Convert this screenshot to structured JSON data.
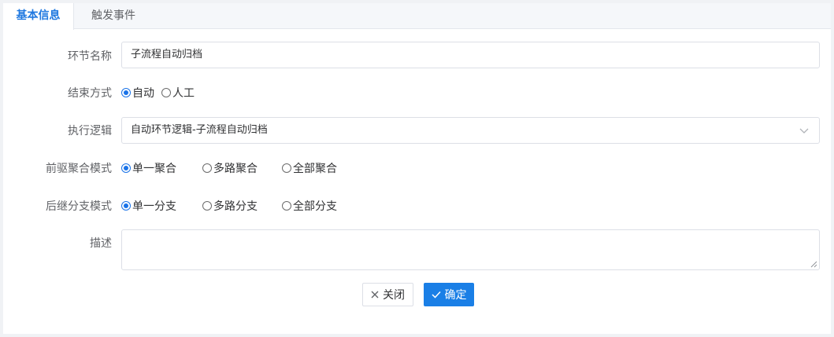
{
  "tabs": [
    {
      "label": "基本信息",
      "active": true
    },
    {
      "label": "触发事件",
      "active": false
    }
  ],
  "form": {
    "node_name": {
      "label": "环节名称",
      "value": "子流程自动归档"
    },
    "end_mode": {
      "label": "结束方式",
      "options": [
        "自动",
        "人工"
      ],
      "selected": "自动"
    },
    "exec_logic": {
      "label": "执行逻辑",
      "value": "自动环节逻辑-子流程自动归档"
    },
    "pre_mode": {
      "label": "前驱聚合模式",
      "options": [
        "单一聚合",
        "多路聚合",
        "全部聚合"
      ],
      "selected": "单一聚合"
    },
    "post_mode": {
      "label": "后继分支模式",
      "options": [
        "单一分支",
        "多路分支",
        "全部分支"
      ],
      "selected": "单一分支"
    },
    "description": {
      "label": "描述",
      "value": ""
    }
  },
  "buttons": {
    "close_label": "关闭",
    "confirm_label": "确定"
  },
  "colors": {
    "accent": "#1a7fe6",
    "tab_active_text": "#1f78e0"
  },
  "icons": {
    "close_button": "close-icon",
    "confirm_button": "check-icon",
    "select": "chevron-down-icon"
  }
}
